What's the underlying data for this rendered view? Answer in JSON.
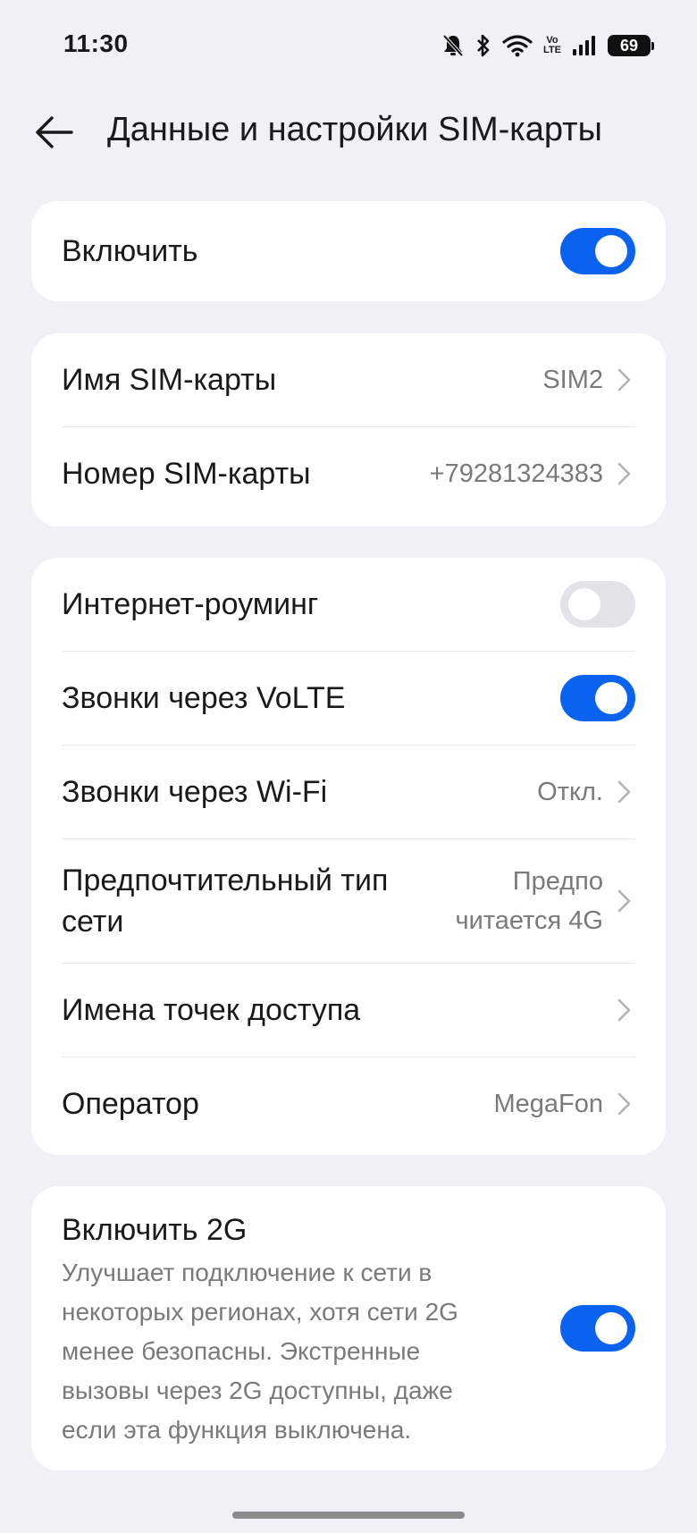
{
  "status_bar": {
    "time": "11:30",
    "icons": [
      "bell-off-icon",
      "bluetooth-icon",
      "wifi-icon",
      "volte-icon",
      "signal-icon",
      "battery-icon"
    ],
    "volte_top": "Vo",
    "volte_bottom": "LTE",
    "battery": "69"
  },
  "header": {
    "back_icon": "arrow-left-icon",
    "title": "Данные и настройки SIM-карты"
  },
  "enable_card": {
    "label": "Включить",
    "toggle_on": true
  },
  "sim_card": {
    "name_label": "Имя SIM-карты",
    "name_value": "SIM2",
    "number_label": "Номер SIM-карты",
    "number_value": "+79281324383"
  },
  "network_card": {
    "roaming_label": "Интернет-роуминг",
    "roaming_on": false,
    "volte_label": "Звонки через VoLTE",
    "volte_on": true,
    "wifi_calls_label": "Звонки через Wi-Fi",
    "wifi_calls_value": "Откл.",
    "network_type_label_1": "Предпочтительный тип",
    "network_type_label_2": "сети",
    "network_type_value_1": "Предпо",
    "network_type_value_2": "читается 4G",
    "apn_label": "Имена точек доступа",
    "operator_label": "Оператор",
    "operator_value": "MegaFon"
  },
  "twog_card": {
    "title": "Включить 2G",
    "description": "Улучшает подключение к сети в некоторых регионах, хотя сети 2G менее безопасны. Экстренные вызовы через 2G доступны, даже если эта функция выключена.",
    "toggle_on": true
  },
  "colors": {
    "accent": "#0a62f0",
    "background": "#f0f1f4",
    "card": "#ffffff",
    "secondary_text": "#7a7a7a"
  }
}
